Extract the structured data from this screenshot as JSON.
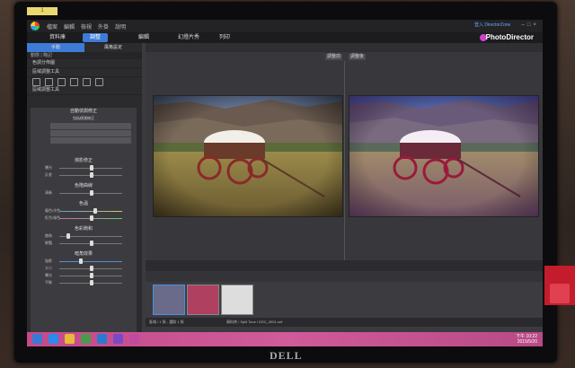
{
  "sticker": {
    "text": "1"
  },
  "app": {
    "menu": [
      "檔案",
      "編輯",
      "檢視",
      "外掛",
      "說明"
    ],
    "login": "登入 DirectorZone",
    "brand": "PhotoDirector",
    "modes": [
      "資料庫",
      "調整",
      "編輯",
      "幻燈片秀",
      "列印"
    ]
  },
  "left": {
    "tabs": [
      "手動",
      "風格設定"
    ],
    "sub": "動態 | 略記",
    "rows": [
      "色調分佈圖",
      "區域調整工具",
      "區域調整工具"
    ],
    "adj": {
      "section1": "自動偵測修正",
      "check": "包括偵測修正",
      "dd": [
        "",
        "",
        ""
      ],
      "section2": "燒影修正",
      "s2rows": [
        "曝光",
        "反差"
      ],
      "section3": "色階曲線",
      "s3rows": [
        "清晰"
      ],
      "section4": "色溫",
      "s4rows": [
        "暖色/冷色",
        "紅色/綠色"
      ],
      "section5": "色彩飽和",
      "s5rows": [
        "飽和",
        "鮮豔"
      ],
      "section6": "暗角效果",
      "s6rows": [
        "陰影",
        "大小",
        "曝光",
        "平衡"
      ]
    },
    "bottom": [
      "重設",
      "貼上",
      "複製",
      "確定"
    ]
  },
  "viewer": {
    "label_before": "調整前",
    "label_after": "調整後"
  },
  "status": {
    "path": "區域 / 1 張 - 選取 1 張",
    "file": "資料夾 / Split Tone / DSC_0001.nef"
  },
  "taskbar": {
    "time": "下午 10:22",
    "date": "2015/5/20"
  },
  "monitor": {
    "brand": "DELL"
  }
}
